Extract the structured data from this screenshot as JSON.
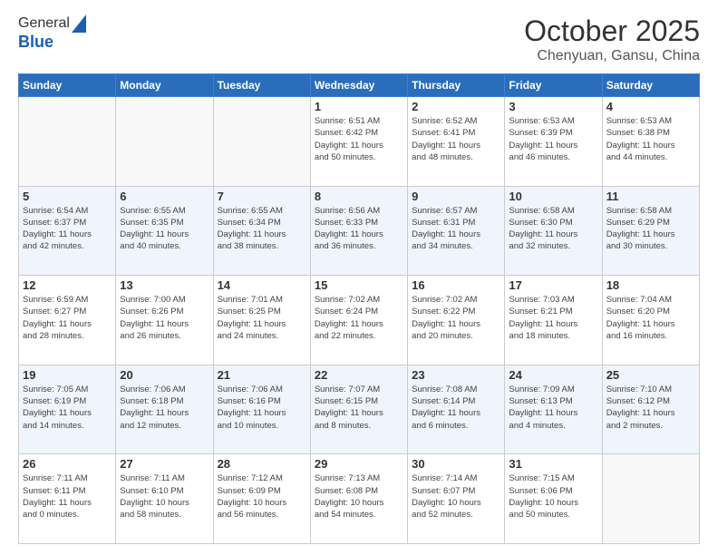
{
  "header": {
    "logo_line1": "General",
    "logo_line2": "Blue",
    "month": "October 2025",
    "location": "Chenyuan, Gansu, China"
  },
  "weekdays": [
    "Sunday",
    "Monday",
    "Tuesday",
    "Wednesday",
    "Thursday",
    "Friday",
    "Saturday"
  ],
  "rows": [
    [
      {
        "num": "",
        "info": ""
      },
      {
        "num": "",
        "info": ""
      },
      {
        "num": "",
        "info": ""
      },
      {
        "num": "1",
        "info": "Sunrise: 6:51 AM\nSunset: 6:42 PM\nDaylight: 11 hours\nand 50 minutes."
      },
      {
        "num": "2",
        "info": "Sunrise: 6:52 AM\nSunset: 6:41 PM\nDaylight: 11 hours\nand 48 minutes."
      },
      {
        "num": "3",
        "info": "Sunrise: 6:53 AM\nSunset: 6:39 PM\nDaylight: 11 hours\nand 46 minutes."
      },
      {
        "num": "4",
        "info": "Sunrise: 6:53 AM\nSunset: 6:38 PM\nDaylight: 11 hours\nand 44 minutes."
      }
    ],
    [
      {
        "num": "5",
        "info": "Sunrise: 6:54 AM\nSunset: 6:37 PM\nDaylight: 11 hours\nand 42 minutes."
      },
      {
        "num": "6",
        "info": "Sunrise: 6:55 AM\nSunset: 6:35 PM\nDaylight: 11 hours\nand 40 minutes."
      },
      {
        "num": "7",
        "info": "Sunrise: 6:55 AM\nSunset: 6:34 PM\nDaylight: 11 hours\nand 38 minutes."
      },
      {
        "num": "8",
        "info": "Sunrise: 6:56 AM\nSunset: 6:33 PM\nDaylight: 11 hours\nand 36 minutes."
      },
      {
        "num": "9",
        "info": "Sunrise: 6:57 AM\nSunset: 6:31 PM\nDaylight: 11 hours\nand 34 minutes."
      },
      {
        "num": "10",
        "info": "Sunrise: 6:58 AM\nSunset: 6:30 PM\nDaylight: 11 hours\nand 32 minutes."
      },
      {
        "num": "11",
        "info": "Sunrise: 6:58 AM\nSunset: 6:29 PM\nDaylight: 11 hours\nand 30 minutes."
      }
    ],
    [
      {
        "num": "12",
        "info": "Sunrise: 6:59 AM\nSunset: 6:27 PM\nDaylight: 11 hours\nand 28 minutes."
      },
      {
        "num": "13",
        "info": "Sunrise: 7:00 AM\nSunset: 6:26 PM\nDaylight: 11 hours\nand 26 minutes."
      },
      {
        "num": "14",
        "info": "Sunrise: 7:01 AM\nSunset: 6:25 PM\nDaylight: 11 hours\nand 24 minutes."
      },
      {
        "num": "15",
        "info": "Sunrise: 7:02 AM\nSunset: 6:24 PM\nDaylight: 11 hours\nand 22 minutes."
      },
      {
        "num": "16",
        "info": "Sunrise: 7:02 AM\nSunset: 6:22 PM\nDaylight: 11 hours\nand 20 minutes."
      },
      {
        "num": "17",
        "info": "Sunrise: 7:03 AM\nSunset: 6:21 PM\nDaylight: 11 hours\nand 18 minutes."
      },
      {
        "num": "18",
        "info": "Sunrise: 7:04 AM\nSunset: 6:20 PM\nDaylight: 11 hours\nand 16 minutes."
      }
    ],
    [
      {
        "num": "19",
        "info": "Sunrise: 7:05 AM\nSunset: 6:19 PM\nDaylight: 11 hours\nand 14 minutes."
      },
      {
        "num": "20",
        "info": "Sunrise: 7:06 AM\nSunset: 6:18 PM\nDaylight: 11 hours\nand 12 minutes."
      },
      {
        "num": "21",
        "info": "Sunrise: 7:06 AM\nSunset: 6:16 PM\nDaylight: 11 hours\nand 10 minutes."
      },
      {
        "num": "22",
        "info": "Sunrise: 7:07 AM\nSunset: 6:15 PM\nDaylight: 11 hours\nand 8 minutes."
      },
      {
        "num": "23",
        "info": "Sunrise: 7:08 AM\nSunset: 6:14 PM\nDaylight: 11 hours\nand 6 minutes."
      },
      {
        "num": "24",
        "info": "Sunrise: 7:09 AM\nSunset: 6:13 PM\nDaylight: 11 hours\nand 4 minutes."
      },
      {
        "num": "25",
        "info": "Sunrise: 7:10 AM\nSunset: 6:12 PM\nDaylight: 11 hours\nand 2 minutes."
      }
    ],
    [
      {
        "num": "26",
        "info": "Sunrise: 7:11 AM\nSunset: 6:11 PM\nDaylight: 11 hours\nand 0 minutes."
      },
      {
        "num": "27",
        "info": "Sunrise: 7:11 AM\nSunset: 6:10 PM\nDaylight: 10 hours\nand 58 minutes."
      },
      {
        "num": "28",
        "info": "Sunrise: 7:12 AM\nSunset: 6:09 PM\nDaylight: 10 hours\nand 56 minutes."
      },
      {
        "num": "29",
        "info": "Sunrise: 7:13 AM\nSunset: 6:08 PM\nDaylight: 10 hours\nand 54 minutes."
      },
      {
        "num": "30",
        "info": "Sunrise: 7:14 AM\nSunset: 6:07 PM\nDaylight: 10 hours\nand 52 minutes."
      },
      {
        "num": "31",
        "info": "Sunrise: 7:15 AM\nSunset: 6:06 PM\nDaylight: 10 hours\nand 50 minutes."
      },
      {
        "num": "",
        "info": ""
      }
    ]
  ]
}
